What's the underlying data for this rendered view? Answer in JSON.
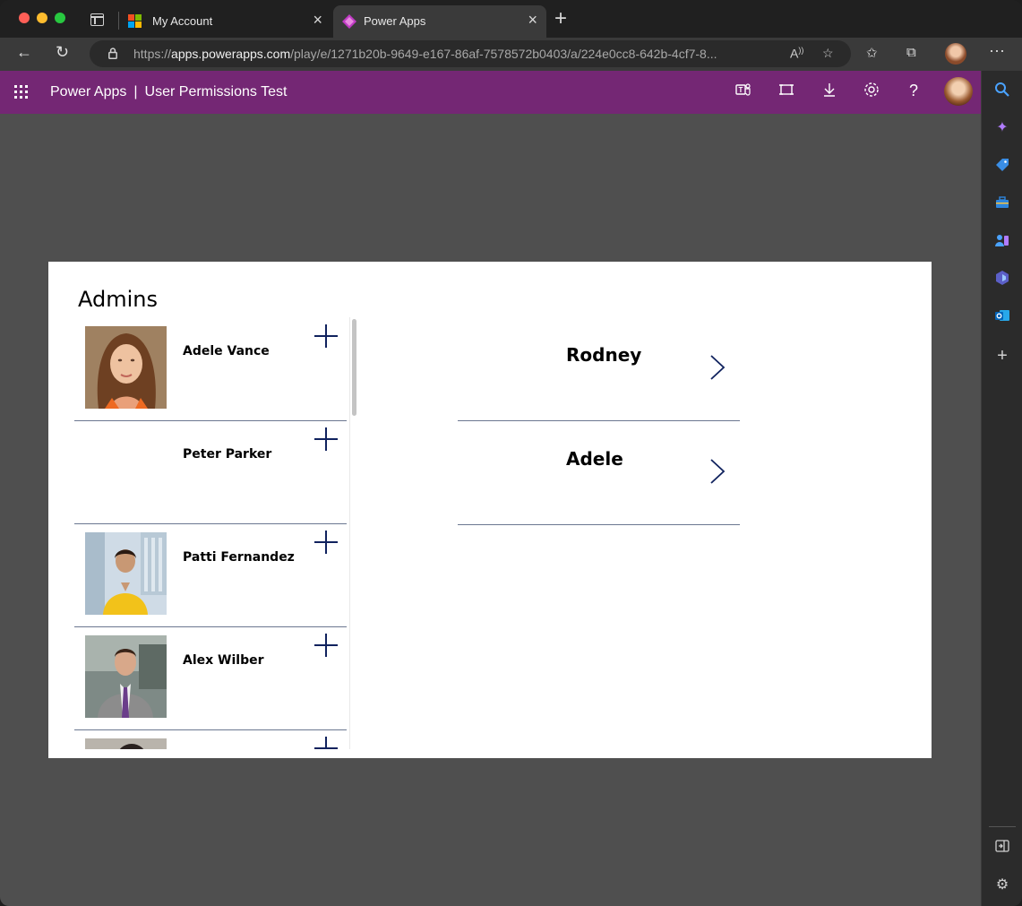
{
  "browser": {
    "tabs": [
      {
        "title": "My Account"
      },
      {
        "title": "Power Apps"
      }
    ],
    "url_prefix": "https://",
    "url_domain": "apps.powerapps.com",
    "url_rest": "/play/e/1271b20b-9649-e167-86af-7578572b0403/a/224e0cc8-642b-4cf7-8..."
  },
  "appbar": {
    "product": "Power Apps",
    "separator": "|",
    "app_name": "User Permissions Test"
  },
  "canvas": {
    "title": "Admins",
    "gallery": [
      {
        "name": "Adele Vance",
        "has_photo": true
      },
      {
        "name": "Peter Parker",
        "has_photo": false
      },
      {
        "name": "Patti Fernandez",
        "has_photo": true
      },
      {
        "name": "Alex Wilber",
        "has_photo": true
      },
      {
        "name": "",
        "has_photo": true
      }
    ],
    "selected": [
      {
        "name": "Rodney"
      },
      {
        "name": "Adele"
      }
    ]
  },
  "colors": {
    "appbar": "#742774",
    "accent_navy": "#10225e",
    "stage": "#4f4f4f"
  }
}
